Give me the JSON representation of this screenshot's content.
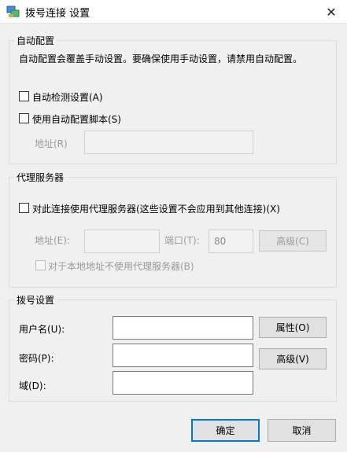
{
  "window": {
    "title": "拨号连接 设置",
    "close_glyph": "✕",
    "app_icon": "network-connection-icon"
  },
  "auto_config": {
    "title": "自动配置",
    "description": "自动配置会覆盖手动设置。要确保使用手动设置，请禁用自动配置。",
    "auto_detect_label": "自动检测设置(A)",
    "use_script_label": "使用自动配置脚本(S)",
    "address_label": "地址(R)",
    "address_value": ""
  },
  "proxy": {
    "title": "代理服务器",
    "use_proxy_label": "对此连接使用代理服务器(这些设置不会应用到其他连接)(X)",
    "address_label": "地址(E):",
    "address_value": "",
    "port_label": "端口(T):",
    "port_value": "80",
    "advanced_label": "高级(C)",
    "bypass_local_label": "对于本地地址不使用代理服务器(B)"
  },
  "dialup": {
    "title": "拨号设置",
    "username_label": "用户名(U):",
    "username_value": "",
    "password_label": "密码(P):",
    "password_value": "",
    "domain_label": "域(D):",
    "domain_value": "",
    "properties_label": "属性(O)",
    "advanced_label": "高级(V)"
  },
  "footer": {
    "ok_label": "确定",
    "cancel_label": "取消"
  },
  "colors": {
    "default_button_border": "#0078d7",
    "window_bg": "#f0f0f0"
  }
}
